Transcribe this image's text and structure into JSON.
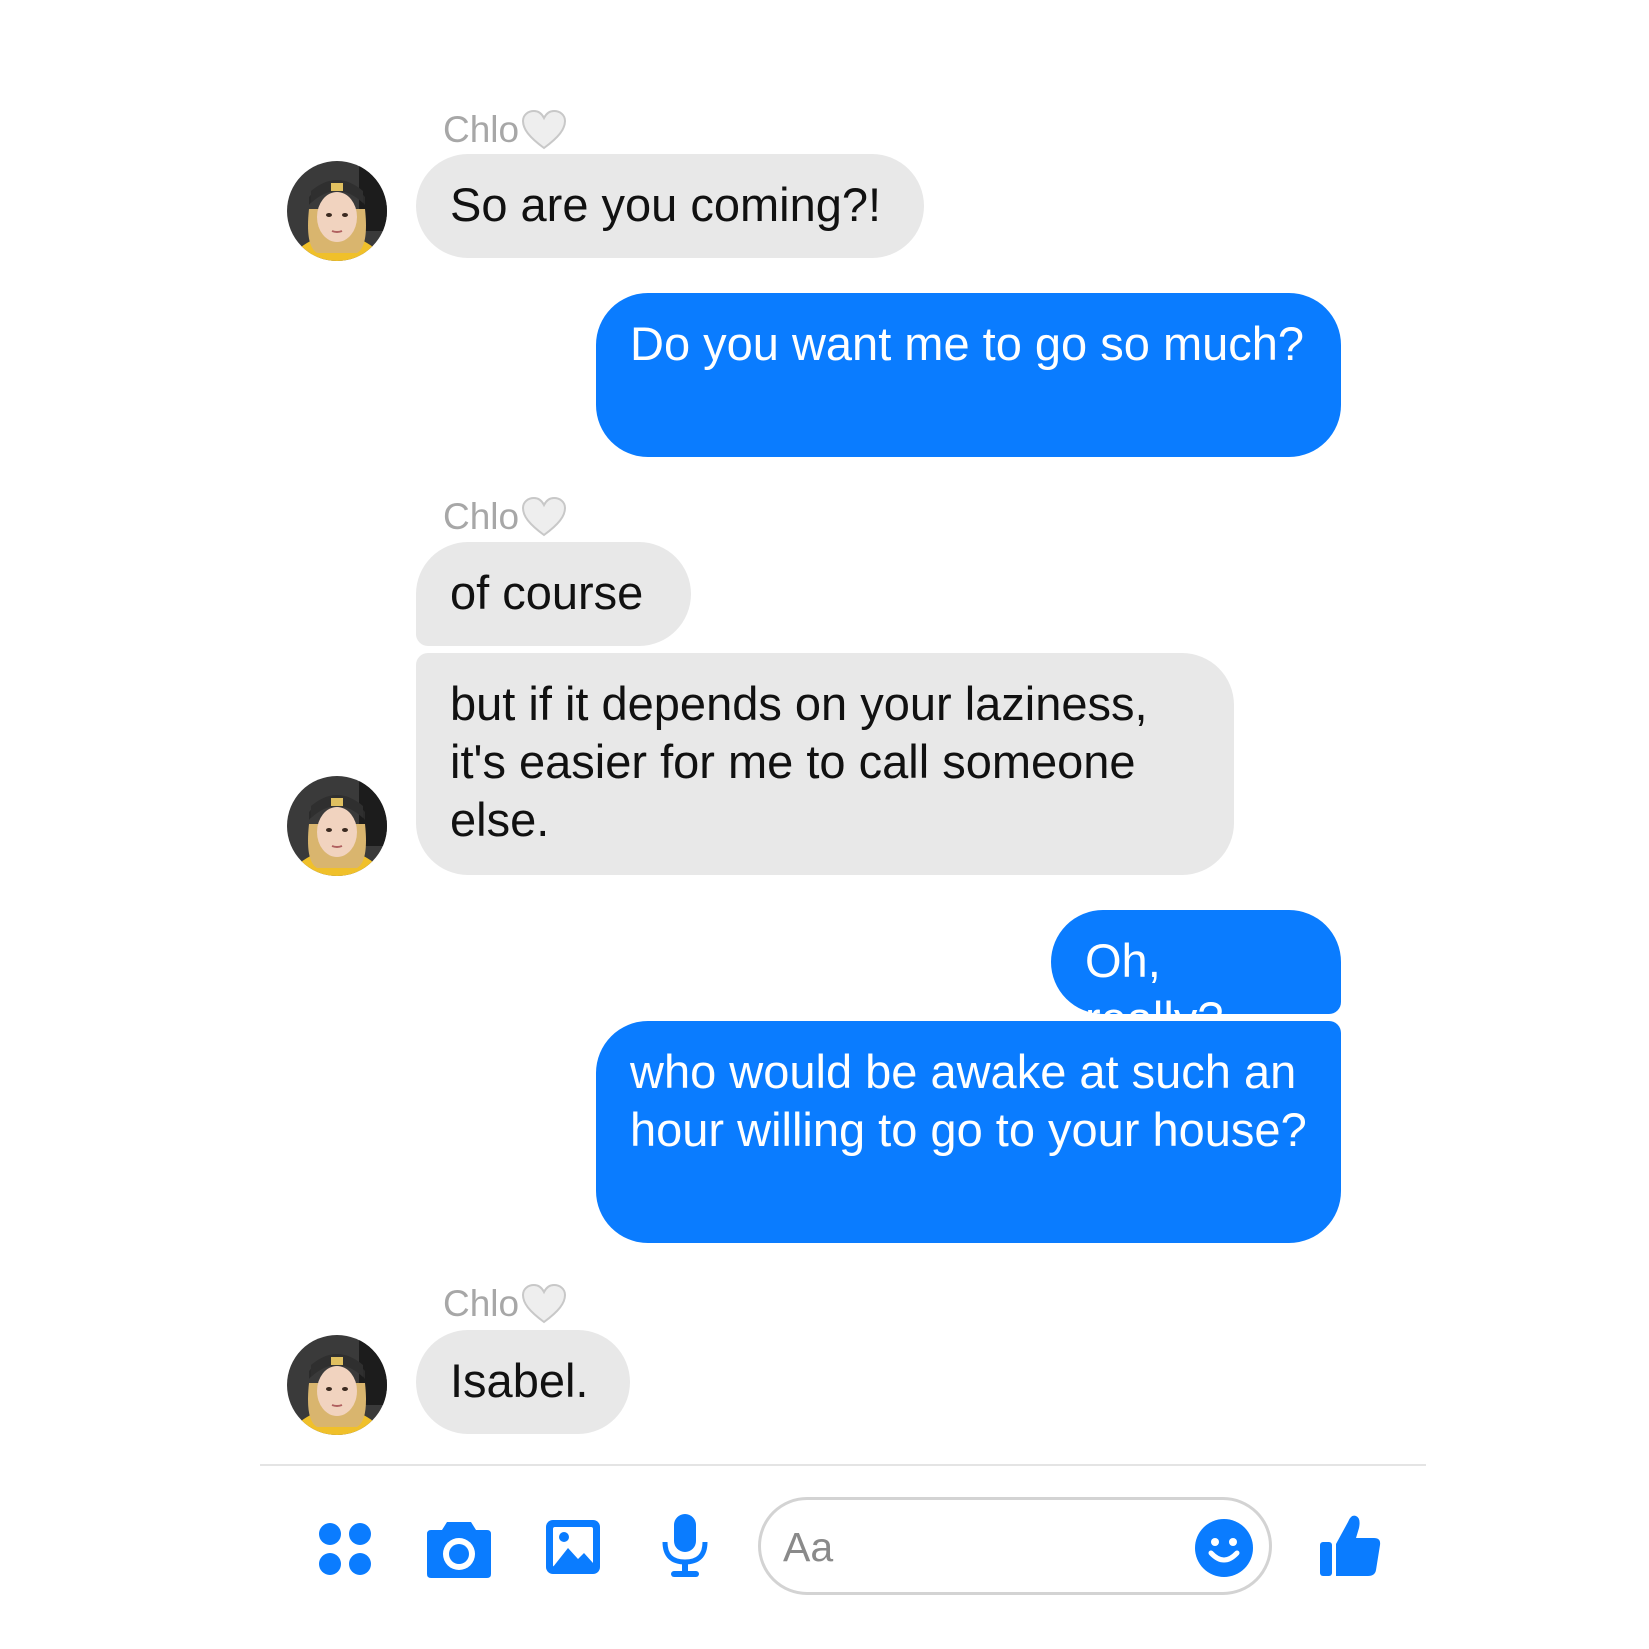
{
  "contact": {
    "name": "Chlo",
    "avatar_icon": "avatar-photo"
  },
  "messages": [
    {
      "from": "contact",
      "text": "So are you coming?!"
    },
    {
      "from": "me",
      "text": "Do you want me to go so much?"
    },
    {
      "from": "contact",
      "text": "of course"
    },
    {
      "from": "contact",
      "text": "but if it depends on your laziness, it's easier for me to call someone else."
    },
    {
      "from": "me",
      "text": "Oh, really?"
    },
    {
      "from": "me",
      "text": "who would be awake at such an hour willing to go to your house?"
    },
    {
      "from": "contact",
      "text": "Isabel."
    }
  ],
  "composer": {
    "placeholder": "Aa"
  },
  "toolbar": {
    "icons": [
      "menu-dots-icon",
      "camera-icon",
      "gallery-icon",
      "microphone-icon",
      "emoji-icon",
      "thumbs-up-icon"
    ]
  },
  "colors": {
    "accent": "#0a7cff",
    "incoming_bubble": "#e8e8e8",
    "sender_label": "#a7a7a7"
  }
}
